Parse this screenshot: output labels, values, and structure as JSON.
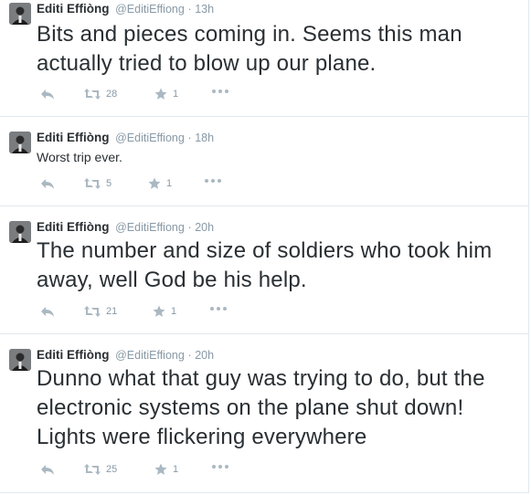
{
  "tweets": [
    {
      "name": "Editi Effiòng",
      "handle": "@EditiEffiong",
      "separator": "·",
      "time": "13h",
      "text": "Bits and pieces coming in. Seems this man actually tried to blow up our plane.",
      "retweets": "28",
      "favorites": "1"
    },
    {
      "name": "Editi Effiòng",
      "handle": "@EditiEffiong",
      "separator": "·",
      "time": "18h",
      "text": "Worst trip ever.",
      "retweets": "5",
      "favorites": "1"
    },
    {
      "name": "Editi Effiòng",
      "handle": "@EditiEffiong",
      "separator": "·",
      "time": "20h",
      "text": "The number and size of soldiers who took him away, well God be his help.",
      "retweets": "21",
      "favorites": "1"
    },
    {
      "name": "Editi Effiòng",
      "handle": "@EditiEffiong",
      "separator": "·",
      "time": "20h",
      "text": "Dunno what that guy was trying to do, but the electronic systems on the plane shut down! Lights were flickering everywhere",
      "retweets": "25",
      "favorites": "1"
    }
  ],
  "icons": {
    "reply": "reply-icon",
    "retweet": "retweet-icon",
    "favorite": "star-icon",
    "more": "more-icon"
  },
  "colors": {
    "text": "#292f33",
    "muted": "#8899a6",
    "action_icon": "#aab8c2",
    "divider": "#e1e8ed"
  }
}
